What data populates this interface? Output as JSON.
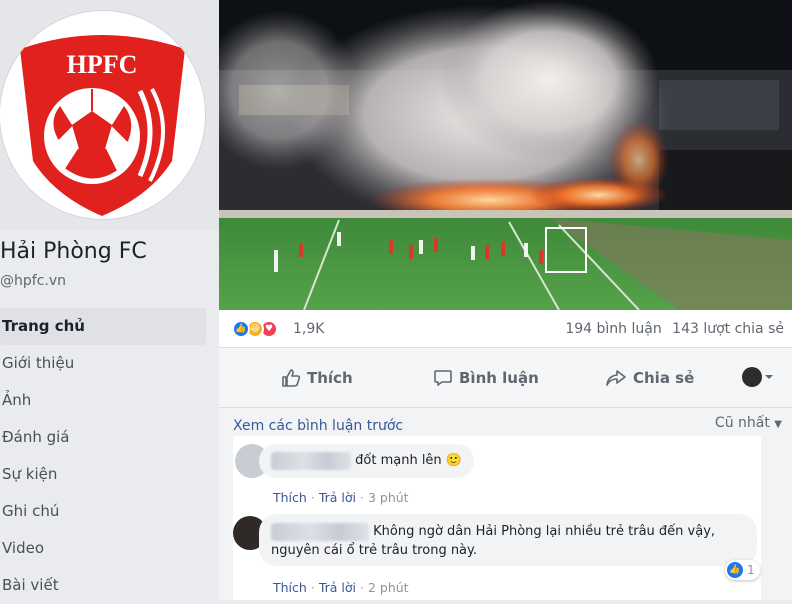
{
  "page": {
    "avatar_text": "HPFC",
    "title": "Hải Phòng FC",
    "handle": "@hpfc.vn"
  },
  "nav": {
    "items": [
      {
        "label": "Trang chủ",
        "active": true
      },
      {
        "label": "Giới thiệu"
      },
      {
        "label": "Ảnh"
      },
      {
        "label": "Đánh giá"
      },
      {
        "label": "Sự kiện"
      },
      {
        "label": "Ghi chú"
      },
      {
        "label": "Video"
      },
      {
        "label": "Bài viết"
      }
    ]
  },
  "post": {
    "reactions": {
      "count": "1,9K",
      "comments": "194 bình luận",
      "shares": "143 lượt chia sẻ",
      "icons": [
        "like-icon",
        "haha-icon",
        "love-icon"
      ]
    },
    "actions": {
      "like": "Thích",
      "comment": "Bình luận",
      "share": "Chia sẻ"
    }
  },
  "comments": {
    "view_previous": "Xem các bình luận trước",
    "sort_label": "Cũ nhất",
    "items": [
      {
        "text": "đốt mạnh lên 🙂",
        "like": "Thích",
        "reply": "Trả lời",
        "time": "3 phút"
      },
      {
        "text_line1": "Không ngờ dân Hải Phòng lại nhiều trẻ trâu đến vậy,",
        "text_line2": "nguyên cái ổ trẻ trâu trong này.",
        "like": "Thích",
        "reply": "Trả lời",
        "time": "2 phút",
        "likes": "1"
      }
    ]
  },
  "colors": {
    "brand_red": "#e0211d",
    "fb_blue": "#385898",
    "like_blue": "#1877f2"
  }
}
